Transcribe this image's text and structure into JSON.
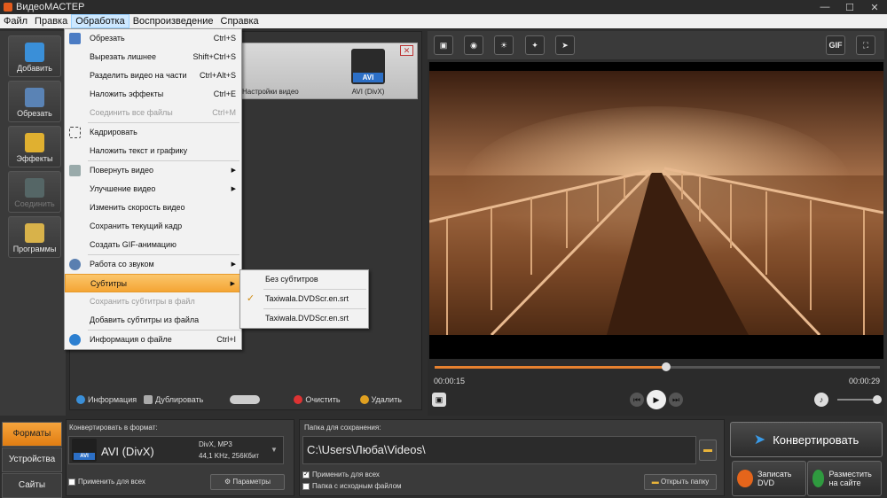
{
  "window": {
    "title": "ВидеоМАСТЕР"
  },
  "menubar": [
    "Файл",
    "Правка",
    "Обработка",
    "Воспроизведение",
    "Справка"
  ],
  "menubar_active": "Обработка",
  "leftbar": [
    {
      "label": "Добавить",
      "icon": "add-video-icon"
    },
    {
      "label": "Обрезать",
      "icon": "cut-icon"
    },
    {
      "label": "Эффекты",
      "icon": "effects-icon"
    },
    {
      "label": "Соединить",
      "icon": "join-icon",
      "disabled": true
    },
    {
      "label": "Программы",
      "icon": "programs-icon"
    }
  ],
  "file_item": {
    "format_badge": "AVI",
    "format_name": "AVI (DivX)",
    "settings_label": "Настройки видео"
  },
  "bottom_tools": {
    "info": "Информация",
    "duplicate": "Дублировать",
    "clear": "Очистить",
    "delete": "Удалить"
  },
  "menu_processing": {
    "items": [
      {
        "label": "Обрезать",
        "shortcut": "Ctrl+S",
        "icon": "cut-icon"
      },
      {
        "label": "Вырезать лишнее",
        "shortcut": "Shift+Ctrl+S"
      },
      {
        "label": "Разделить видео на части",
        "shortcut": "Ctrl+Alt+S"
      },
      {
        "label": "Наложить эффекты",
        "shortcut": "Ctrl+E"
      },
      {
        "label": "Соединить все файлы",
        "shortcut": "Ctrl+M",
        "disabled": true
      },
      {
        "label": "Кадрировать",
        "shortcut": "",
        "icon": "crop-icon"
      },
      {
        "label": "Наложить текст и графику",
        "shortcut": ""
      },
      {
        "label": "Повернуть видео",
        "submenu": true,
        "icon": "rotate-icon"
      },
      {
        "label": "Улучшение видео",
        "submenu": true
      },
      {
        "label": "Изменить скорость видео"
      },
      {
        "label": "Сохранить текущий кадр"
      },
      {
        "label": "Создать GIF-анимацию"
      },
      {
        "label": "Работа со звуком",
        "submenu": true,
        "icon": "sound-icon"
      },
      {
        "label": "Субтитры",
        "submenu": true,
        "highlighted": true
      },
      {
        "label": "Сохранить субтитры в файл",
        "disabled": true
      },
      {
        "label": "Добавить субтитры из файла"
      },
      {
        "label": "Информация о файле",
        "shortcut": "Ctrl+I",
        "icon": "info-icon"
      }
    ]
  },
  "submenu_subtitles": {
    "items": [
      {
        "label": "Без субтитров",
        "checked": false
      },
      {
        "label": "Taxiwala.DVDScr.en.srt",
        "checked": true
      },
      {
        "label": "Taxiwala.DVDScr.en.srt",
        "checked": false
      }
    ]
  },
  "player": {
    "time_current": "00:00:15",
    "time_total": "00:00:29",
    "progress": 0.52,
    "gif_label": "GIF"
  },
  "tabs": {
    "formats": "Форматы",
    "devices": "Устройства",
    "sites": "Сайты"
  },
  "convert_format": {
    "label": "Конвертировать в формат:",
    "format": "AVI (DivX)",
    "badge": "AVI",
    "spec1": "DivX, MP3",
    "spec2": "44,1 KHz, 256Кбит",
    "apply_all": "Применить для всех",
    "params": "Параметры"
  },
  "save_folder": {
    "label": "Папка для сохранения:",
    "path": "C:\\Users\\Люба\\Videos\\",
    "apply_all": "Применить для всех",
    "source_folder": "Папка с исходным файлом",
    "open_folder": "Открыть папку"
  },
  "actions": {
    "convert": "Конвертировать",
    "burn_dvd": "Записать DVD",
    "publish": "Разместить на сайте"
  },
  "colors": {
    "accent": "#f4a535",
    "seek": "#e6812f",
    "badge_blue": "#2c6fc6"
  }
}
